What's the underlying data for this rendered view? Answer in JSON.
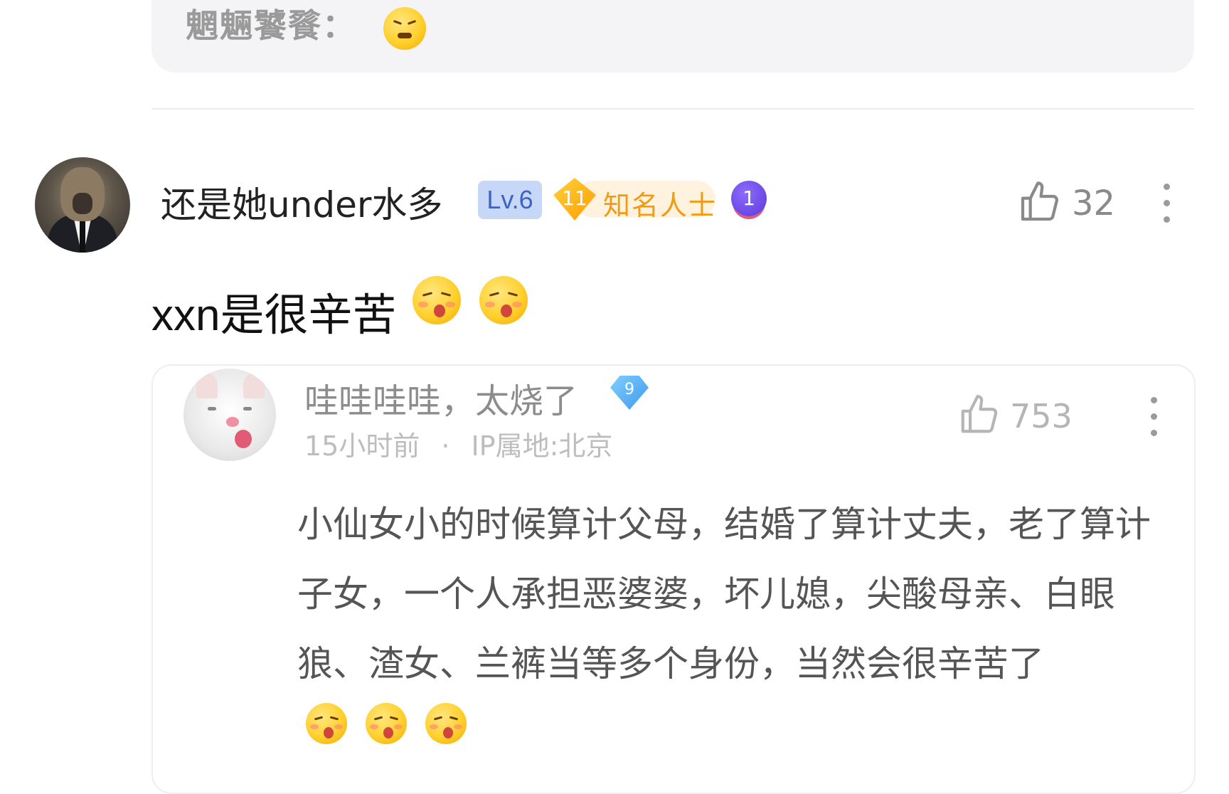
{
  "top_quote": {
    "text": "魍魎饕餮："
  },
  "comment": {
    "username": "还是她under水多",
    "level": "Lv.6",
    "fame_level": "11",
    "fame_title": "知名人士",
    "medal": "1",
    "likes": "32",
    "text": "xxn是很辛苦",
    "emoji_count": 2
  },
  "reply": {
    "username": "哇哇哇哇，太烧了",
    "gem_level": "9",
    "time": "15小时前",
    "separator": "·",
    "ip": "IP属地:北京",
    "likes": "753",
    "body": "小仙女小的时候算计父母，结婚了算计丈夫，老了算计子女，一个人承担恶婆婆，坏儿媳，尖酸母亲、白眼狼、渣女、兰裤当等多个身份，当然会很辛苦了",
    "emoji_count": 3
  },
  "colors": {
    "level_badge_bg": "#c7d7f7",
    "level_badge_text": "#3f63c4",
    "fame_accent": "#f29b11",
    "meta_gray": "#bdbdbd"
  },
  "icons": [
    "thumb-up-icon",
    "more-vertical-icon",
    "diamond-icon",
    "medal-icon",
    "emoji-yum-icon",
    "emoji-angry-icon"
  ]
}
